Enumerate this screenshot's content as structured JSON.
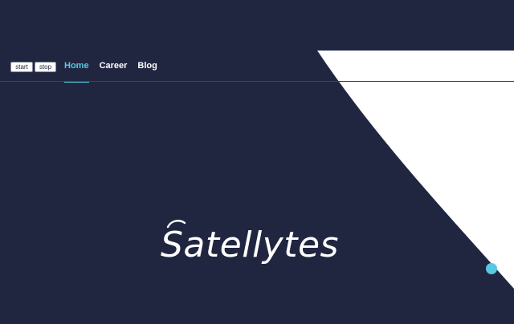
{
  "controls": {
    "start_label": "start",
    "stop_label": "stop"
  },
  "nav": {
    "items": [
      {
        "label": "Home",
        "active": true
      },
      {
        "label": "Career",
        "active": false
      },
      {
        "label": "Blog",
        "active": false
      }
    ]
  },
  "logo": {
    "text": "Satellytes"
  },
  "colors": {
    "background": "#212640",
    "accent": "#5ac8e0",
    "shape": "#ffffff"
  }
}
